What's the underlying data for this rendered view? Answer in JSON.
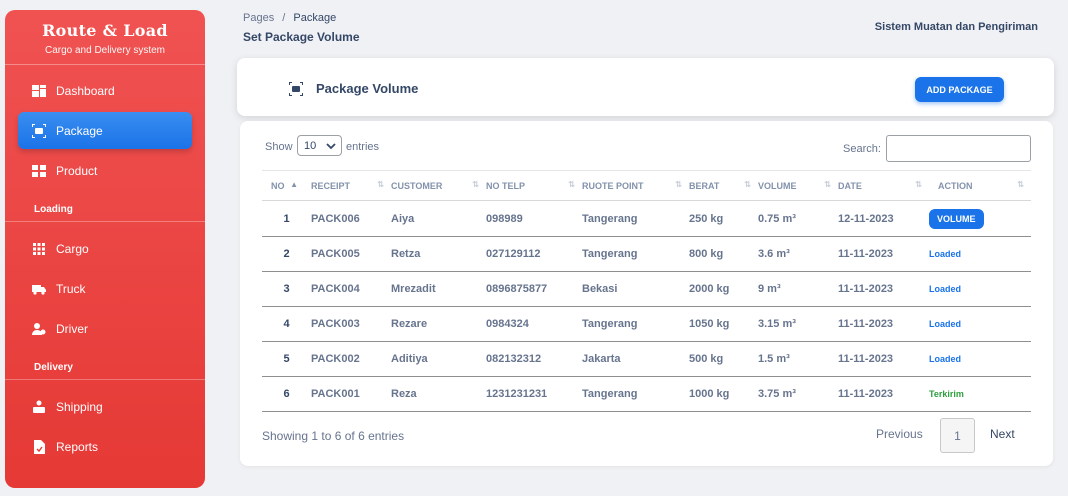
{
  "sidebar": {
    "brand_title": "Route & Load",
    "brand_subtitle": "Cargo and Delivery system",
    "items": [
      {
        "label": "Dashboard",
        "icon": "dashboard-icon"
      },
      {
        "label": "Package",
        "icon": "package-scan-icon",
        "active": true
      },
      {
        "label": "Product",
        "icon": "product-icon"
      },
      {
        "label": "Cargo",
        "icon": "cargo-grid-icon"
      },
      {
        "label": "Truck",
        "icon": "truck-icon"
      },
      {
        "label": "Driver",
        "icon": "driver-icon"
      },
      {
        "label": "Shipping",
        "icon": "shipping-icon"
      },
      {
        "label": "Reports",
        "icon": "reports-icon"
      }
    ],
    "sections": {
      "loading": "Loading",
      "delivery": "Delivery"
    }
  },
  "header": {
    "breadcrumb_root": "Pages",
    "breadcrumb_sep": "/",
    "breadcrumb_current": "Package",
    "page_title": "Set Package Volume",
    "app_name": "Sistem Muatan dan Pengiriman"
  },
  "volume_card": {
    "title": "Package Volume",
    "add_button": "ADD PACKAGE"
  },
  "table_controls": {
    "show_label": "Show",
    "entries_value": "10",
    "entries_label": "entries",
    "search_label": "Search:",
    "search_value": ""
  },
  "table": {
    "columns": [
      "NO",
      "RECEIPT",
      "CUSTOMER",
      "NO TELP",
      "RUOTE POINT",
      "BERAT",
      "VOLUME",
      "DATE",
      "ACTION"
    ],
    "rows": [
      {
        "no": "1",
        "receipt": "PACK006",
        "customer": "Aiya",
        "telp": "098989",
        "route": "Tangerang",
        "berat": "250 kg",
        "volume": "0.75 m³",
        "date": "12-11-2023",
        "action": "VOLUME",
        "action_type": "button"
      },
      {
        "no": "2",
        "receipt": "PACK005",
        "customer": "Retza",
        "telp": "027129112",
        "route": "Tangerang",
        "berat": "800 kg",
        "volume": "3.6 m³",
        "date": "11-11-2023",
        "action": "Loaded",
        "action_type": "loaded"
      },
      {
        "no": "3",
        "receipt": "PACK004",
        "customer": "Mrezadit",
        "telp": "0896875877",
        "route": "Bekasi",
        "berat": "2000 kg",
        "volume": "9 m³",
        "date": "11-11-2023",
        "action": "Loaded",
        "action_type": "loaded"
      },
      {
        "no": "4",
        "receipt": "PACK003",
        "customer": "Rezare",
        "telp": "0984324",
        "route": "Tangerang",
        "berat": "1050 kg",
        "volume": "3.15 m³",
        "date": "11-11-2023",
        "action": "Loaded",
        "action_type": "loaded"
      },
      {
        "no": "5",
        "receipt": "PACK002",
        "customer": "Aditiya",
        "telp": "082132312",
        "route": "Jakarta",
        "berat": "500 kg",
        "volume": "1.5 m³",
        "date": "11-11-2023",
        "action": "Loaded",
        "action_type": "loaded"
      },
      {
        "no": "6",
        "receipt": "PACK001",
        "customer": "Reza",
        "telp": "1231231231",
        "route": "Tangerang",
        "berat": "1000 kg",
        "volume": "3.75 m³",
        "date": "11-11-2023",
        "action": "Terkirim",
        "action_type": "sent"
      }
    ]
  },
  "footer": {
    "info": "Showing 1 to 6 of 6 entries",
    "previous": "Previous",
    "page": "1",
    "next": "Next"
  },
  "colors": {
    "sidebar": "#e53935",
    "accent": "#1a73e8",
    "sent": "#2e9e3e"
  }
}
